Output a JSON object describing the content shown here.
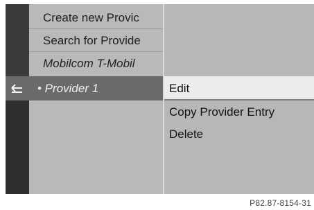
{
  "list": {
    "items": [
      "Create new Provic",
      "Search for Provide",
      "Mobilcom T-Mobil"
    ],
    "selected": "• Provider 1"
  },
  "menu": {
    "items": [
      "Edit",
      "Copy Provider Entry",
      "Delete"
    ]
  },
  "icons": {
    "back": "back-arrow-icon"
  },
  "caption": "P82.87-8154-31"
}
